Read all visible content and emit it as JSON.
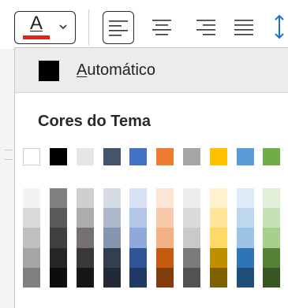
{
  "toolbar": {
    "font_color_letter": "A",
    "font_color_bar": "#e2231a",
    "icons": [
      "font-color-icon",
      "chevron-down-icon",
      "align-left-icon",
      "align-center-icon",
      "align-right-icon",
      "align-justify-icon",
      "line-spacing-icon"
    ]
  },
  "panel": {
    "automatic": {
      "label_underlined": "A",
      "label_rest": "utomático",
      "color": "#000000"
    },
    "theme_colors_title": "Cores do Tema",
    "theme_colors": [
      "#ffffff",
      "#000000",
      "#e7e6e6",
      "#44546a",
      "#4472c4",
      "#ed7d31",
      "#a5a5a5",
      "#ffc000",
      "#5b9bd5",
      "#70ad47"
    ],
    "shades": [
      [
        "#f2f2f2",
        "#d9d9d9",
        "#bfbfbf",
        "#a6a6a6",
        "#808080"
      ],
      [
        "#808080",
        "#595959",
        "#404040",
        "#262626",
        "#0d0d0d"
      ],
      [
        "#d0cece",
        "#aeabab",
        "#757171",
        "#3a3838",
        "#171616"
      ],
      [
        "#d6dce4",
        "#adb9ca",
        "#8496b0",
        "#333f4f",
        "#222a35"
      ],
      [
        "#d9e2f3",
        "#b4c6e7",
        "#8eaadb",
        "#2f5496",
        "#1f3864"
      ],
      [
        "#fbe5d5",
        "#f7caac",
        "#f4b183",
        "#c55a11",
        "#833c0b"
      ],
      [
        "#ededed",
        "#dbdbdb",
        "#c9c9c9",
        "#7b7b7b",
        "#525252"
      ],
      [
        "#fff2cc",
        "#fee599",
        "#ffd966",
        "#bf8f00",
        "#7f6000"
      ],
      [
        "#deebf6",
        "#bdd7ee",
        "#9dc3e6",
        "#2e75b5",
        "#1f4e79"
      ],
      [
        "#e2efd9",
        "#c5e0b3",
        "#a8d08d",
        "#538135",
        "#375623"
      ]
    ]
  }
}
